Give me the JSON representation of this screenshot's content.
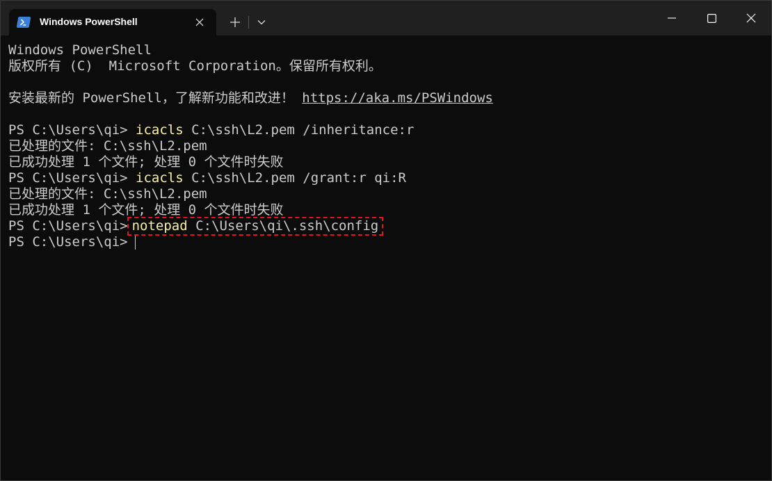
{
  "window": {
    "tab_title": "Windows PowerShell",
    "icons": {
      "tab": "powershell-icon",
      "tab_close": "close-icon",
      "new_tab": "plus-icon",
      "dropdown": "chevron-down-icon",
      "minimize": "minimize-icon",
      "maximize": "maximize-icon",
      "close": "close-icon"
    }
  },
  "colors": {
    "background": "#0c0c0c",
    "titlebar": "#202020",
    "text": "#cccccc",
    "command": "#f9f1a5",
    "highlight_border": "#e81123"
  },
  "terminal": {
    "banner_1": "Windows PowerShell",
    "banner_2": "版权所有 (C)  Microsoft Corporation。保留所有权利。",
    "install_text": "安装最新的 PowerShell，了解新功能和改进！",
    "install_link": "https://aka.ms/PSWindows",
    "prompt": "PS C:\\Users\\qi>",
    "cmd1_name": "icacls",
    "cmd1_args": "C:\\ssh\\L2.pem /inheritance:r",
    "out1_a": "已处理的文件: C:\\ssh\\L2.pem",
    "out1_b": "已成功处理 1 个文件; 处理 0 个文件时失败",
    "cmd2_name": "icacls",
    "cmd2_args": "C:\\ssh\\L2.pem /grant:r qi:R",
    "out2_a": "已处理的文件: C:\\ssh\\L2.pem",
    "out2_b": "已成功处理 1 个文件; 处理 0 个文件时失败",
    "cmd3_name": "notepad",
    "cmd3_args": "C:\\Users\\qi\\.ssh\\config"
  }
}
